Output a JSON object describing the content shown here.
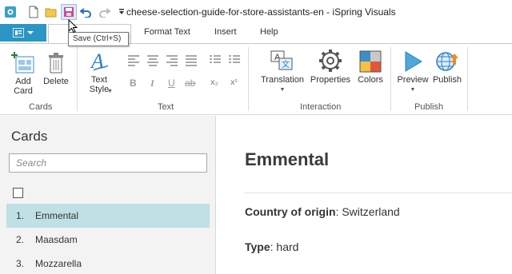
{
  "app": {
    "title": "cheese-selection-guide-for-store-assistants-en - iSpring Visuals"
  },
  "tooltip": "Save (Ctrl+S)",
  "tabs": [
    {
      "label": "Format Text"
    },
    {
      "label": "Insert"
    },
    {
      "label": "Help"
    }
  ],
  "ribbon": {
    "cards": {
      "add_card": "Add\nCard",
      "delete": "Delete",
      "group": "Cards"
    },
    "text": {
      "text_style": "Text\nStyle",
      "group": "Text",
      "bold": "B",
      "italic": "I",
      "underline": "U",
      "strike": "ab",
      "subscript": "x₂",
      "superscript": "x²"
    },
    "interaction": {
      "translation": "Translation",
      "properties": "Properties",
      "colors": "Colors",
      "group": "Interaction"
    },
    "publish": {
      "preview": "Preview",
      "publish": "Publish",
      "group": "Publish"
    }
  },
  "sidebar": {
    "title": "Cards",
    "search_placeholder": "Search",
    "items": [
      {
        "num": "1.",
        "name": "Emmental",
        "selected": true
      },
      {
        "num": "2.",
        "name": "Maasdam",
        "selected": false
      },
      {
        "num": "3.",
        "name": "Mozzarella",
        "selected": false
      }
    ]
  },
  "card": {
    "title": "Emmental",
    "fields": [
      {
        "label": "Country of origin",
        "value": "Switzerland"
      },
      {
        "label": "Type",
        "value": "hard"
      }
    ]
  },
  "colors": {
    "accent": "#2b96c5",
    "selected_row": "#bfe0e4"
  }
}
